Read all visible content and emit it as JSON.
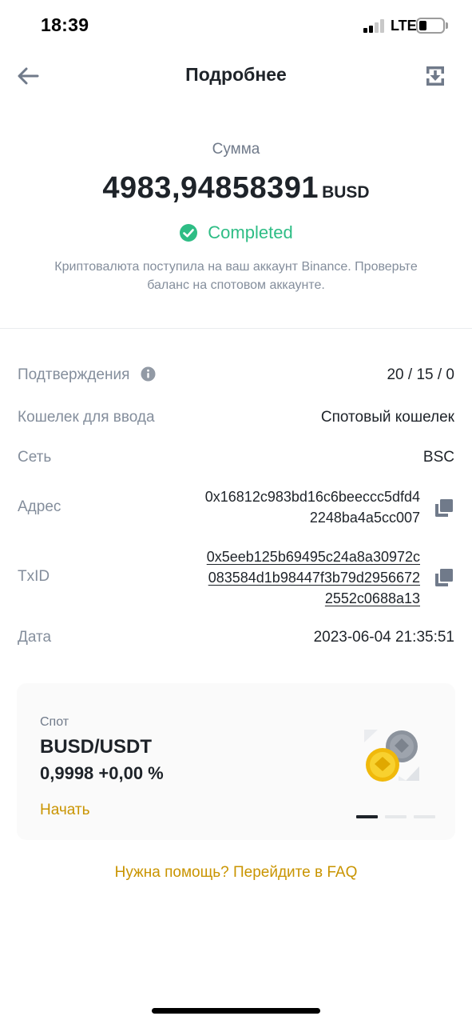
{
  "status_bar": {
    "time": "18:39",
    "network": "LTE"
  },
  "nav": {
    "title": "Подробнее",
    "back_icon": "arrow-left-icon",
    "share_icon": "download-share-icon"
  },
  "summary": {
    "label": "Сумма",
    "amount": "4983,94858391",
    "currency": "BUSD",
    "status": "Completed",
    "status_color": "#2ebd85",
    "note": "Криптовалюта поступила на ваш аккаунт Binance. Проверьте баланс на спотовом аккаунте."
  },
  "details": {
    "confirmations": {
      "label": "Подтверждения",
      "value": "20 / 15 / 0"
    },
    "wallet": {
      "label": "Кошелек для ввода",
      "value": "Спотовый кошелек"
    },
    "network": {
      "label": "Сеть",
      "value": "BSC"
    },
    "address": {
      "label": "Адрес",
      "line1": "0x16812c983bd16c6beeccc5dfd4",
      "line2": "2248ba4a5cc007"
    },
    "txid": {
      "label": "TxID",
      "line1": "0x5eeb125b69495c24a8a30972c",
      "line2": "083584d1b98447f3b79d2956672",
      "line3": "2552c0688a13"
    },
    "date": {
      "label": "Дата",
      "value": "2023-06-04 21:35:51"
    }
  },
  "promo_card": {
    "kicker": "Спот",
    "pair": "BUSD/USDT",
    "price": "0,9998 +0,00 %",
    "cta": "Начать",
    "accent_color": "#c99400"
  },
  "footer": {
    "faq_link": "Нужна помощь? Перейдите в FAQ"
  }
}
